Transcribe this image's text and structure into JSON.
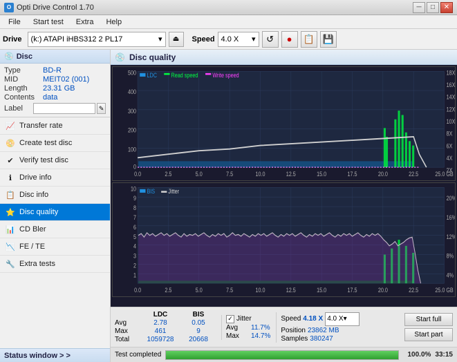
{
  "app": {
    "title": "Opti Drive Control 1.70",
    "icon": "O"
  },
  "titlebar": {
    "title": "Opti Drive Control 1.70",
    "minimize": "─",
    "maximize": "□",
    "close": "✕"
  },
  "menu": {
    "items": [
      "File",
      "Start test",
      "Extra",
      "Help"
    ]
  },
  "drivebar": {
    "drive_label": "Drive",
    "drive_value": "(k:) ATAPI iHBS312  2 PL17",
    "eject_icon": "⏏",
    "speed_label": "Speed",
    "speed_value": "4.0 X",
    "icon1": "↺",
    "icon2": "●",
    "icon3": "📋",
    "icon4": "💾"
  },
  "sidebar": {
    "section_title": "Disc",
    "disc_icon": "💿",
    "disc_fields": [
      {
        "key": "Type",
        "value": "BD-R"
      },
      {
        "key": "MID",
        "value": "MEIT02 (001)"
      },
      {
        "key": "Length",
        "value": "23.31 GB"
      },
      {
        "key": "Contents",
        "value": "data"
      }
    ],
    "label_key": "Label",
    "label_placeholder": "",
    "nav_items": [
      {
        "id": "transfer-rate",
        "label": "Transfer rate",
        "icon": "📈"
      },
      {
        "id": "create-test-disc",
        "label": "Create test disc",
        "icon": "📀"
      },
      {
        "id": "verify-test-disc",
        "label": "Verify test disc",
        "icon": "✔"
      },
      {
        "id": "drive-info",
        "label": "Drive info",
        "icon": "ℹ"
      },
      {
        "id": "disc-info",
        "label": "Disc info",
        "icon": "📋"
      },
      {
        "id": "disc-quality",
        "label": "Disc quality",
        "icon": "⭐",
        "active": true
      },
      {
        "id": "cd-bler",
        "label": "CD Bler",
        "icon": "📊"
      },
      {
        "id": "fe-te",
        "label": "FE / TE",
        "icon": "📉"
      },
      {
        "id": "extra-tests",
        "label": "Extra tests",
        "icon": "🔧"
      }
    ],
    "status_window": "Status window > >"
  },
  "disc_quality": {
    "title": "Disc quality",
    "legend_top": {
      "ldc": "LDC",
      "read_speed": "Read speed",
      "write_speed": "Write speed"
    },
    "legend_bottom": {
      "bis": "BIS",
      "jitter": "Jitter"
    },
    "top_chart": {
      "y_left_max": 500,
      "y_left_ticks": [
        500,
        400,
        300,
        200,
        100,
        0
      ],
      "y_right_ticks": [
        "18X",
        "16X",
        "14X",
        "12X",
        "10X",
        "8X",
        "6X",
        "4X",
        "2X"
      ],
      "x_ticks": [
        "0.0",
        "2.5",
        "5.0",
        "7.5",
        "10.0",
        "12.5",
        "15.0",
        "17.5",
        "20.0",
        "22.5",
        "25.0 GB"
      ]
    },
    "bottom_chart": {
      "y_left_max": 10,
      "y_left_ticks": [
        "10",
        "9",
        "8",
        "7",
        "6",
        "5",
        "4",
        "3",
        "2",
        "1"
      ],
      "y_right_ticks": [
        "20%",
        "16%",
        "12%",
        "8%",
        "4%"
      ],
      "x_ticks": [
        "0.0",
        "2.5",
        "5.0",
        "7.5",
        "10.0",
        "12.5",
        "15.0",
        "17.5",
        "20.0",
        "22.5",
        "25.0 GB"
      ]
    },
    "stats": {
      "columns": [
        "",
        "LDC",
        "BIS",
        "",
        "Jitter",
        "Speed",
        ""
      ],
      "rows": [
        {
          "label": "Avg",
          "ldc": "2.78",
          "bis": "0.05",
          "jitter": "11.7%"
        },
        {
          "label": "Max",
          "ldc": "461",
          "bis": "9",
          "jitter": "14.7%"
        },
        {
          "label": "Total",
          "ldc": "1059728",
          "bis": "20668",
          "jitter": ""
        }
      ],
      "jitter_checked": true,
      "speed_val": "4.18 X",
      "speed_dropdown": "4.0 X",
      "position_label": "Position",
      "position_val": "23862 MB",
      "samples_label": "Samples",
      "samples_val": "380247",
      "btn_start_full": "Start full",
      "btn_start_part": "Start part"
    }
  },
  "bottom": {
    "status_text": "Test completed",
    "progress_pct": "100.0%",
    "time": "33:15"
  }
}
